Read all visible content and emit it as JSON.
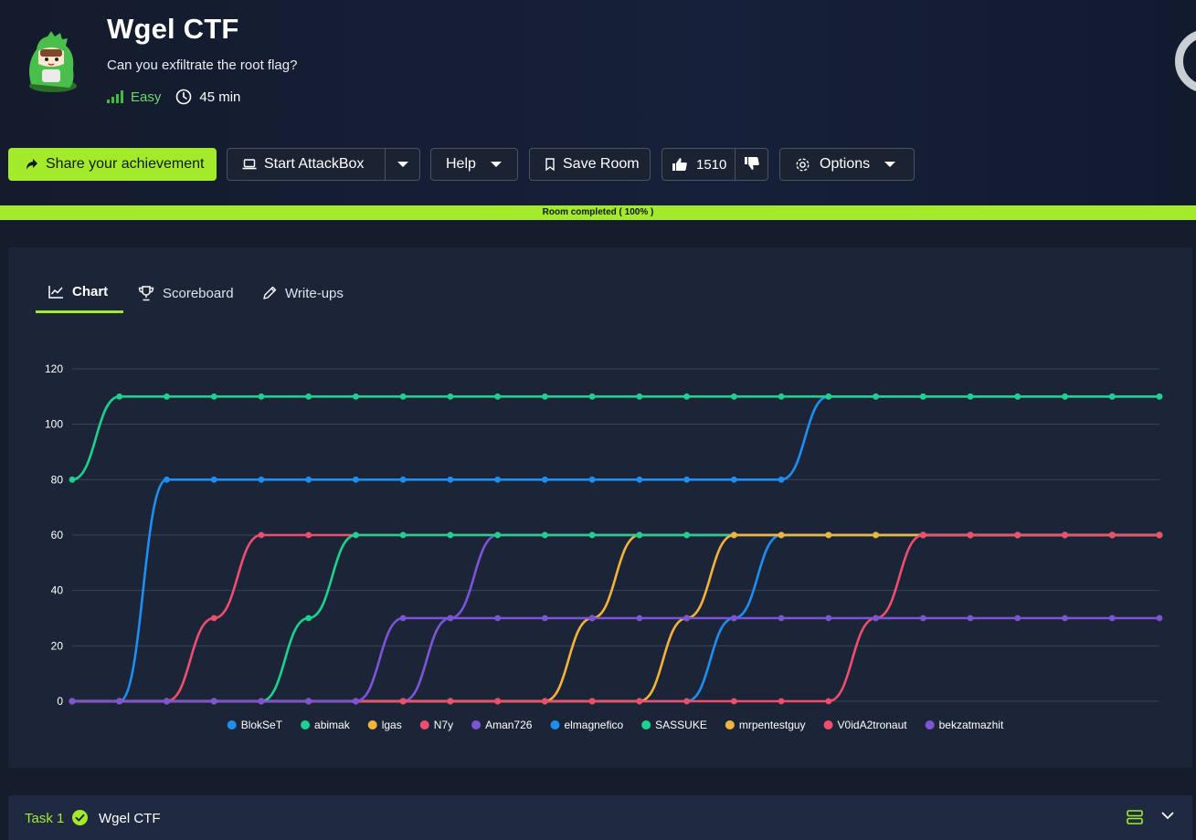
{
  "room": {
    "title": "Wgel CTF",
    "description": "Can you exfiltrate the root flag?",
    "difficulty": "Easy",
    "duration": "45 min",
    "avatar_icon": "green-dinosaur-avatar"
  },
  "toolbar": {
    "share_label": "Share your achievement",
    "attackbox_label": "Start AttackBox",
    "help_label": "Help",
    "save_label": "Save Room",
    "upvotes": "1510",
    "options_label": "Options"
  },
  "progress": {
    "label": "Room completed ( 100% )",
    "percent": 100
  },
  "tabs": [
    {
      "label": "Chart",
      "icon": "line-chart-icon",
      "active": true
    },
    {
      "label": "Scoreboard",
      "icon": "trophy-icon",
      "active": false
    },
    {
      "label": "Write-ups",
      "icon": "pencil-icon",
      "active": false
    }
  ],
  "chart_data": {
    "type": "line",
    "y_ticks": [
      "0",
      "20",
      "40",
      "60",
      "80",
      "100",
      "120"
    ],
    "ylim": [
      0,
      120
    ],
    "x_count": 24,
    "grid": true,
    "legend_position": "bottom",
    "series": [
      {
        "name": "BlokSeT",
        "color": "#1e8ef0",
        "values": [
          0,
          0,
          80,
          80,
          80,
          80,
          80,
          80,
          80,
          80,
          80,
          80,
          80,
          80,
          80,
          80,
          110,
          110,
          110,
          110,
          110,
          110,
          110,
          110
        ]
      },
      {
        "name": "abimak",
        "color": "#1fd18f",
        "values": [
          80,
          110,
          110,
          110,
          110,
          110,
          110,
          110,
          110,
          110,
          110,
          110,
          110,
          110,
          110,
          110,
          110,
          110,
          110,
          110,
          110,
          110,
          110,
          110
        ]
      },
      {
        "name": "lgas",
        "color": "#f4b33b",
        "values": [
          0,
          0,
          0,
          0,
          0,
          0,
          0,
          0,
          0,
          0,
          0,
          30,
          60,
          60,
          60,
          60,
          60,
          60,
          60,
          60,
          60,
          60,
          60,
          60
        ]
      },
      {
        "name": "N7y",
        "color": "#ef4e6e",
        "values": [
          0,
          0,
          0,
          30,
          60,
          60,
          60,
          60,
          60,
          60,
          60,
          60,
          60,
          60,
          60,
          60,
          60,
          60,
          60,
          60,
          60,
          60,
          60,
          60
        ]
      },
      {
        "name": "Aman726",
        "color": "#7b55d6",
        "values": [
          0,
          0,
          0,
          0,
          0,
          0,
          0,
          0,
          30,
          60,
          60,
          60,
          60,
          60,
          60,
          60,
          60,
          60,
          60,
          60,
          60,
          60,
          60,
          60
        ]
      },
      {
        "name": "elmagnefico",
        "color": "#1e8ef0",
        "values": [
          0,
          0,
          0,
          0,
          0,
          0,
          0,
          0,
          0,
          0,
          0,
          0,
          0,
          0,
          30,
          60,
          60,
          60,
          60,
          60,
          60,
          60,
          60,
          60
        ]
      },
      {
        "name": "SASSUKE",
        "color": "#1fd18f",
        "values": [
          0,
          0,
          0,
          0,
          0,
          30,
          60,
          60,
          60,
          60,
          60,
          60,
          60,
          60,
          60,
          60,
          60,
          60,
          60,
          60,
          60,
          60,
          60,
          60
        ]
      },
      {
        "name": "mrpentestguy",
        "color": "#f4b33b",
        "values": [
          0,
          0,
          0,
          0,
          0,
          0,
          0,
          0,
          0,
          0,
          0,
          0,
          0,
          30,
          60,
          60,
          60,
          60,
          60,
          60,
          60,
          60,
          60,
          60
        ]
      },
      {
        "name": "V0idA2tronaut",
        "color": "#ef4e6e",
        "values": [
          0,
          0,
          0,
          0,
          0,
          0,
          0,
          0,
          0,
          0,
          0,
          0,
          0,
          0,
          0,
          0,
          0,
          30,
          60,
          60,
          60,
          60,
          60,
          60
        ]
      },
      {
        "name": "bekzatmazhit",
        "color": "#7b55d6",
        "values": [
          0,
          0,
          0,
          0,
          0,
          0,
          0,
          30,
          30,
          30,
          30,
          30,
          30,
          30,
          30,
          30,
          30,
          30,
          30,
          30,
          30,
          30,
          30,
          30
        ]
      }
    ]
  },
  "task": {
    "number_label": "Task 1",
    "title": "Wgel CTF"
  }
}
